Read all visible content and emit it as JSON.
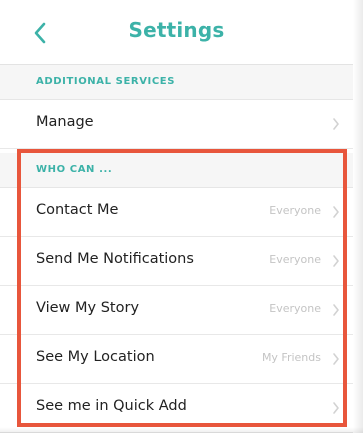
{
  "header": {
    "title": "Settings",
    "back_icon": "chevron-left-icon"
  },
  "additional_services": {
    "heading": "ADDITIONAL SERVICES",
    "manage_label": "Manage"
  },
  "who_can": {
    "heading": "WHO CAN ...",
    "rows": [
      {
        "label": "Contact Me",
        "value": "Everyone"
      },
      {
        "label": "Send Me Notifications",
        "value": "Everyone"
      },
      {
        "label": "View My Story",
        "value": "Everyone"
      },
      {
        "label": "See My Location",
        "value": "My Friends"
      },
      {
        "label": "See me in Quick Add",
        "value": ""
      }
    ]
  },
  "colors": {
    "accent": "#3cb2a8",
    "highlight_border": "#e8563c",
    "section_bg": "#f6f6f6"
  }
}
